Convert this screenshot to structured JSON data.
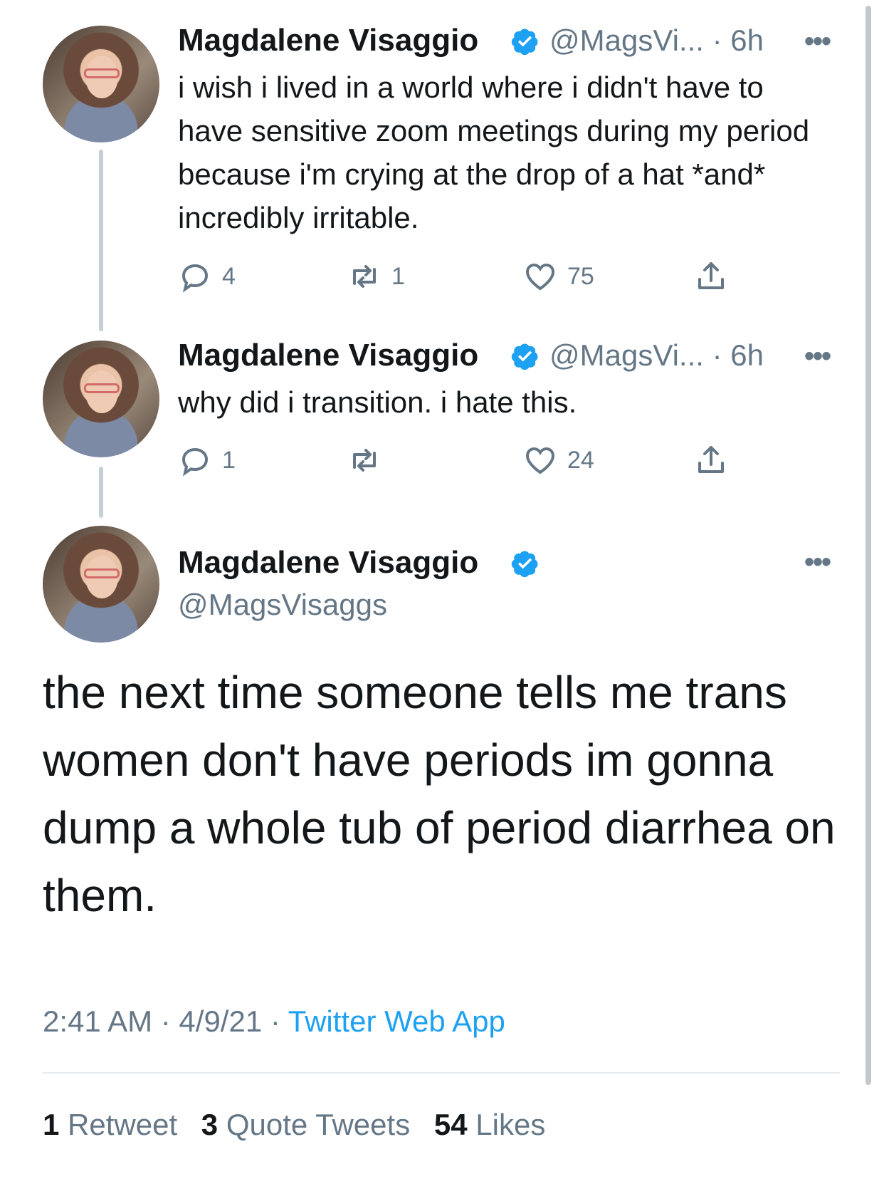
{
  "colors": {
    "accent": "#1da1f2",
    "secondary": "#657786",
    "text": "#14171a",
    "thread_line": "#c4cfd6"
  },
  "tweets": [
    {
      "name": "Magdalene Visaggio",
      "handle_meta": "@MagsVi... · 6h",
      "text": "i wish i lived in a world where i didn't have to have sensitive zoom meetings during my period because i'm crying at the drop of a hat *and* incredibly irritable.",
      "replies": "4",
      "retweets": "1",
      "likes": "75"
    },
    {
      "name": "Magdalene Visaggio",
      "handle_meta": "@MagsVi... · 6h",
      "text": "why did i transition. i hate this.",
      "replies": "1",
      "retweets": "",
      "likes": "24"
    }
  ],
  "main_tweet": {
    "name": "Magdalene Visaggio",
    "handle": "@MagsVisaggs",
    "text": "the next time someone tells me trans women don't have periods im gonna dump a whole tub of period diarrhea on them.",
    "time": "2:41 AM · 4/9/21 · ",
    "source": "Twitter Web App",
    "stats": {
      "retweets_count": "1",
      "retweets_label": "Retweet",
      "quotes_count": "3",
      "quotes_label": "Quote Tweets",
      "likes_count": "54",
      "likes_label": "Likes"
    }
  },
  "icons": [
    "verified-badge-icon",
    "more-icon",
    "reply-icon",
    "retweet-icon",
    "like-icon",
    "share-icon"
  ]
}
